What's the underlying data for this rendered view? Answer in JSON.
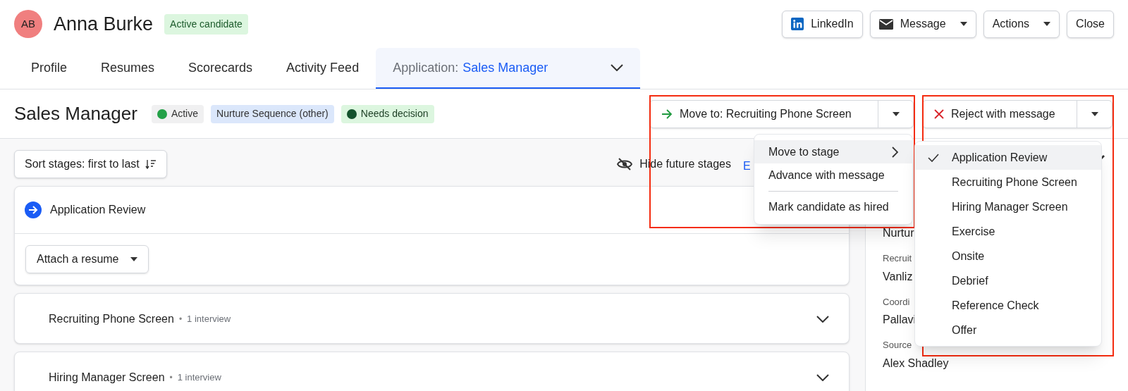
{
  "candidate": {
    "initials": "AB",
    "name": "Anna Burke",
    "status_badge": "Active candidate"
  },
  "header_buttons": [
    {
      "kind": "linkedin",
      "label": "LinkedIn"
    },
    {
      "kind": "message",
      "label": "Message"
    },
    {
      "kind": "actions",
      "label": "Actions"
    },
    {
      "kind": "plain",
      "label": "Close"
    }
  ],
  "tabs": [
    {
      "label": "Profile",
      "selected": false
    },
    {
      "label": "Resumes",
      "selected": false
    },
    {
      "label": "Scorecards",
      "selected": false
    },
    {
      "label": "Activity Feed",
      "selected": false
    },
    {
      "label": "Application:",
      "job": "Sales Manager",
      "selected": true
    }
  ],
  "job": {
    "title": "Sales Manager",
    "badges": [
      {
        "label": "Active",
        "kind": "status",
        "color": "#23a047"
      },
      {
        "label": "Nurture Sequence (other)",
        "kind": "tag"
      },
      {
        "label": "Needs decision",
        "kind": "decision",
        "color": "#14532d"
      }
    ]
  },
  "move_button": {
    "label": "Move to: Recruiting Phone Screen"
  },
  "reject_button": {
    "label": "Reject with message"
  },
  "move_menu": [
    {
      "label": "Move to stage",
      "selected": true,
      "has_submenu": true,
      "separated": false
    },
    {
      "label": "Advance with message",
      "selected": false,
      "has_submenu": false,
      "separated": false
    },
    {
      "label": "Mark candidate as hired",
      "selected": false,
      "has_submenu": false,
      "separated": true
    }
  ],
  "stage_menu": [
    {
      "label": "Application Review",
      "selected": true
    },
    {
      "label": "Recruiting Phone Screen",
      "selected": false
    },
    {
      "label": "Hiring Manager Screen",
      "selected": false
    },
    {
      "label": "Exercise",
      "selected": false
    },
    {
      "label": "Onsite",
      "selected": false
    },
    {
      "label": "Debrief",
      "selected": false
    },
    {
      "label": "Reference Check",
      "selected": false
    },
    {
      "label": "Offer",
      "selected": false
    }
  ],
  "toolbar": {
    "sort": "Sort stages: first to last",
    "hide": "Hide future stages",
    "link": "E"
  },
  "stages": [
    {
      "kind": "current",
      "label": "Application Review",
      "action": "Attach a resume"
    },
    {
      "kind": "collapsed",
      "label": "Recruiting Phone Screen",
      "separator": "•",
      "meta": "1 interview"
    },
    {
      "kind": "collapsed",
      "label": "Hiring Manager Screen",
      "separator": "•",
      "meta": "1 interview"
    }
  ],
  "sidebar": [
    {
      "kind": "value",
      "text": "Nurtur"
    },
    {
      "kind": "label",
      "text": "Recruit"
    },
    {
      "kind": "value",
      "text": "Vanliz"
    },
    {
      "kind": "label",
      "text": "Coordi"
    },
    {
      "kind": "value",
      "text": "Pallavi"
    },
    {
      "kind": "label",
      "text": "Source"
    },
    {
      "kind": "value",
      "text": "Alex Shadley"
    }
  ]
}
